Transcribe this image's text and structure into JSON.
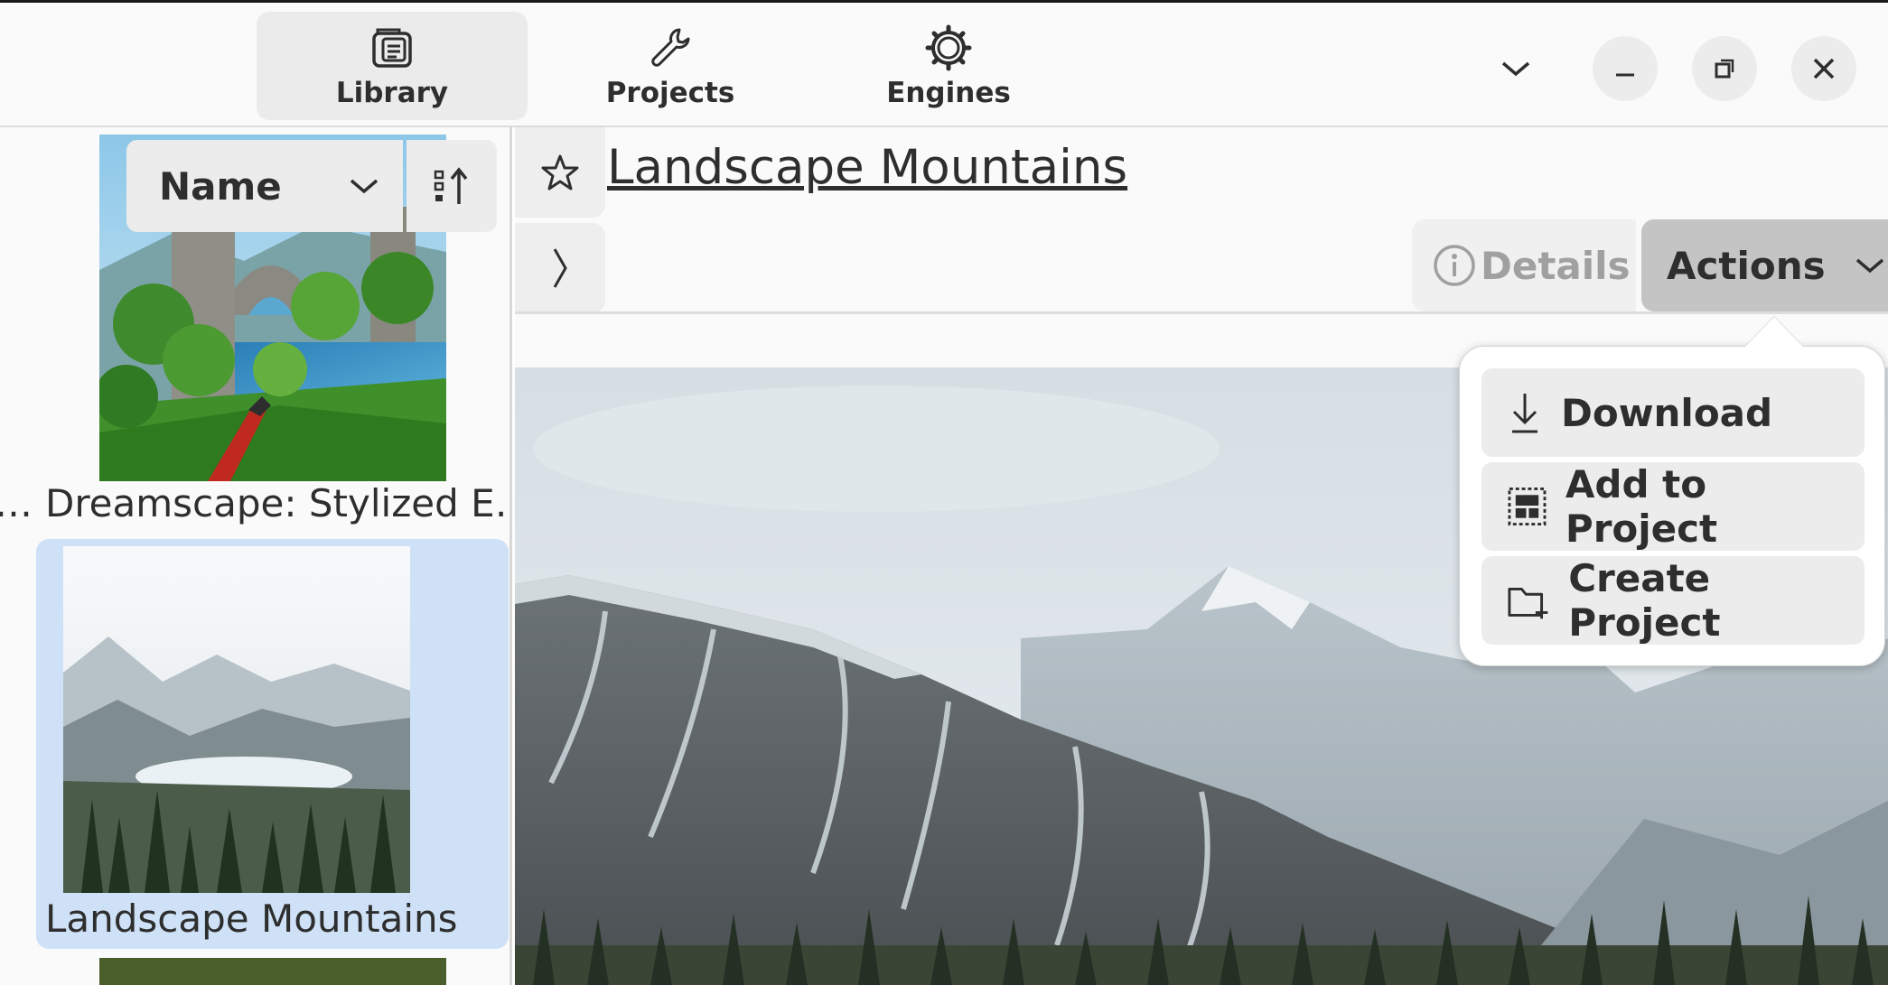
{
  "header": {
    "tabs": [
      {
        "label": "Library",
        "icon": "library-icon",
        "active": true
      },
      {
        "label": "Projects",
        "icon": "wrench-icon",
        "active": false
      },
      {
        "label": "Engines",
        "icon": "gear-icon",
        "active": false
      }
    ],
    "window_controls": [
      "chevron-down-icon",
      "minimize-icon",
      "restore-icon",
      "close-icon"
    ]
  },
  "sidebar": {
    "sort": {
      "field": "Name",
      "direction_icon": "sort-ascending-icon"
    },
    "items": [
      {
        "label": "Dreamscape: Stylized E…",
        "prev_label_fragment": "…",
        "selected": false
      },
      {
        "label": "Landscape Mountains",
        "selected": true
      }
    ]
  },
  "main": {
    "title": "Landscape Mountains",
    "details_label": "Details",
    "actions_label": "Actions"
  },
  "actions_menu": {
    "items": [
      {
        "label": "Download",
        "icon": "download-icon"
      },
      {
        "label": "Add to Project",
        "icon": "add-to-project-icon"
      },
      {
        "label": "Create Project",
        "icon": "create-folder-icon"
      }
    ]
  },
  "colors": {
    "selection": "#cfe1f7",
    "actions_button": "#c4c4c4",
    "control_bg": "#ececec",
    "text": "#2e2e2e"
  }
}
